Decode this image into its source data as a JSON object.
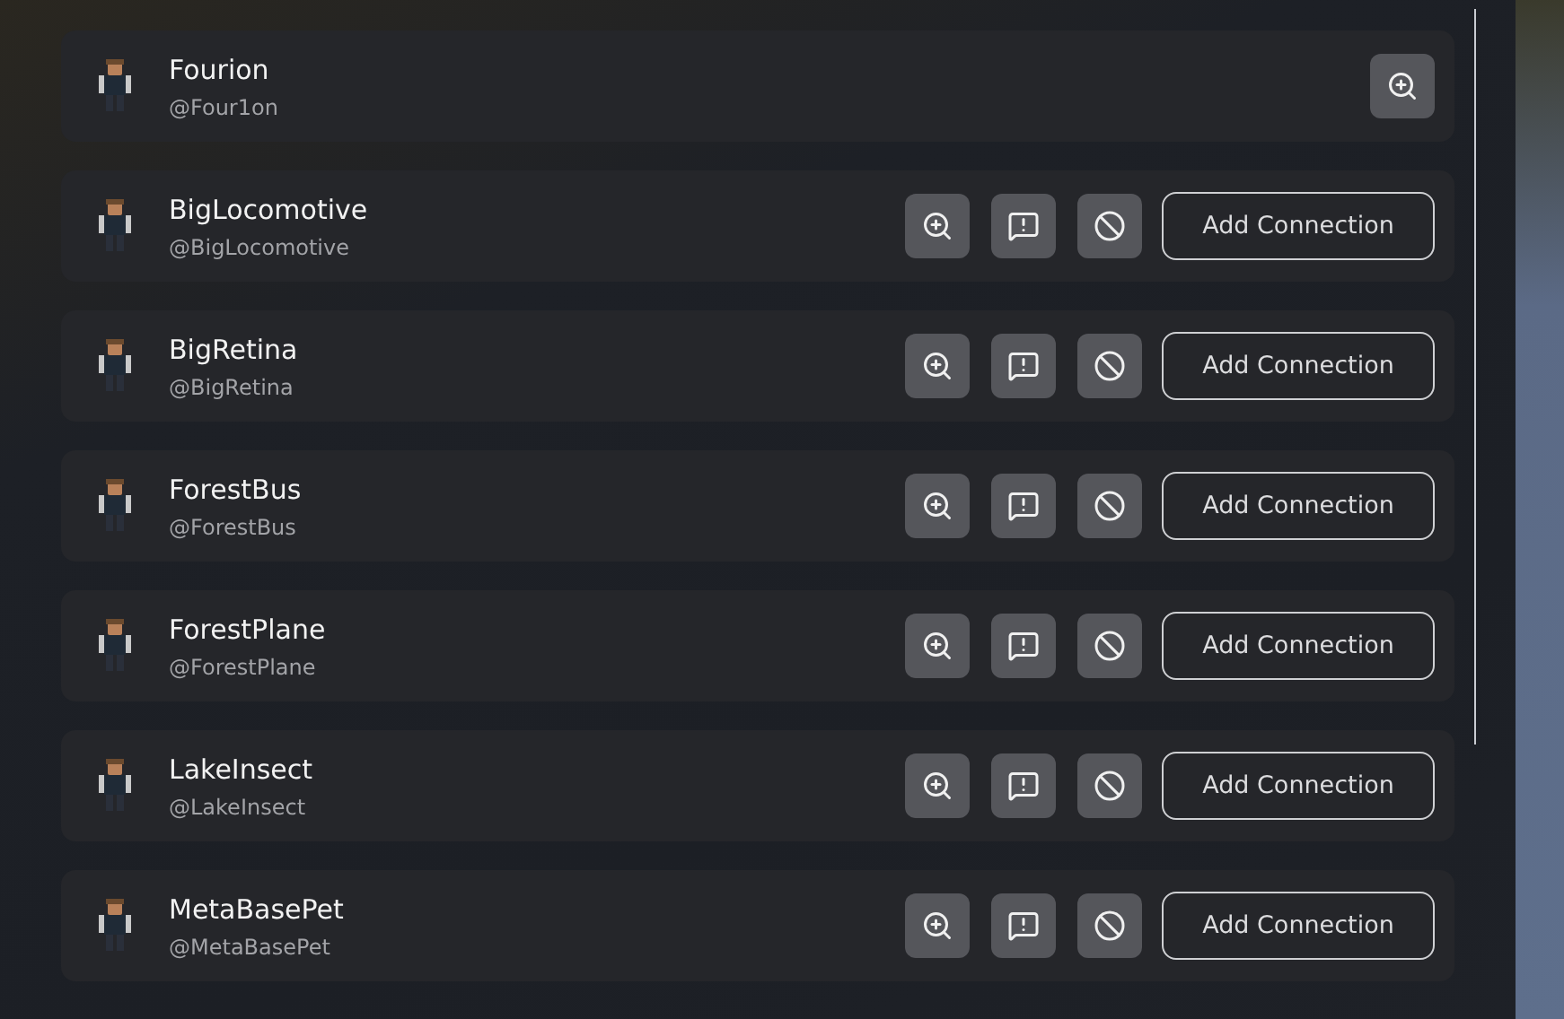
{
  "players": [
    {
      "kind": "self",
      "name": "Fourion",
      "handle": "@Four1on"
    },
    {
      "kind": "other",
      "name": "BigLocomotive",
      "handle": "@BigLocomotive",
      "action": "Add Connection"
    },
    {
      "kind": "other",
      "name": "BigRetina",
      "handle": "@BigRetina",
      "action": "Add Connection"
    },
    {
      "kind": "other",
      "name": "ForestBus",
      "handle": "@ForestBus",
      "action": "Add Connection"
    },
    {
      "kind": "other",
      "name": "ForestPlane",
      "handle": "@ForestPlane",
      "action": "Add Connection"
    },
    {
      "kind": "other",
      "name": "LakeInsect",
      "handle": "@LakeInsect",
      "action": "Add Connection"
    },
    {
      "kind": "other",
      "name": "MetaBasePet",
      "handle": "@MetaBasePet",
      "action": "Add Connection"
    }
  ]
}
